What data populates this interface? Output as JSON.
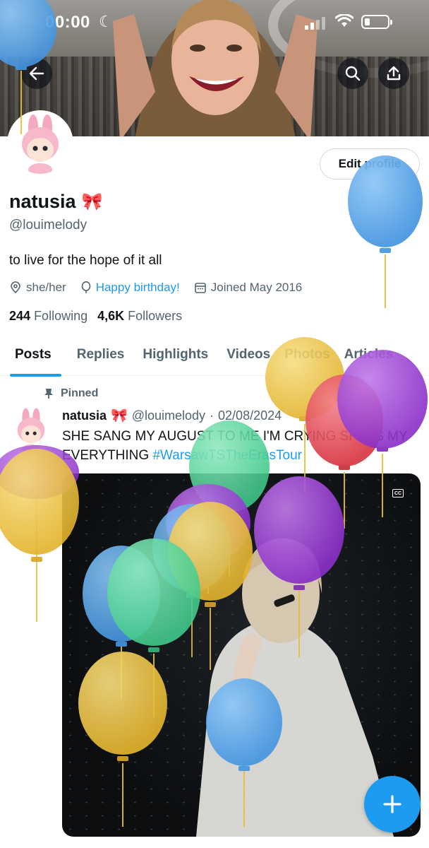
{
  "status_bar": {
    "time": "00:00"
  },
  "profile": {
    "display_name": "natusia",
    "handle": "@louimelody",
    "bio": "to live for the hope of it all",
    "pronouns": "she/her",
    "birthday_text": "Happy birthday!",
    "joined": "Joined May 2016",
    "following_count": "244",
    "following_label": "Following",
    "followers_count": "4,6K",
    "followers_label": "Followers",
    "edit_button": "Edit profile"
  },
  "tabs": [
    {
      "label": "Posts",
      "active": true
    },
    {
      "label": "Replies"
    },
    {
      "label": "Highlights"
    },
    {
      "label": "Videos"
    },
    {
      "label": "Photos"
    },
    {
      "label": "Articles"
    }
  ],
  "post": {
    "pinned_label": "Pinned",
    "author": "natusia",
    "handle": "@louimelody",
    "separator": "·",
    "date": "02/08/2024",
    "text": "SHE SANG MY AUGUST TO ME I'M CRYING SHE IS MY EVERYTHING ",
    "hashtag": "#WarsawTSTheErasTour",
    "cc_label": "CC"
  },
  "colors": {
    "accent": "#1d9bf0",
    "balloon_blue": "#5aa8ec",
    "balloon_yellow": "#f2c94c",
    "balloon_purple": "#9b3fd6",
    "balloon_green": "#5fd6a0",
    "balloon_red": "#e84a5a"
  }
}
